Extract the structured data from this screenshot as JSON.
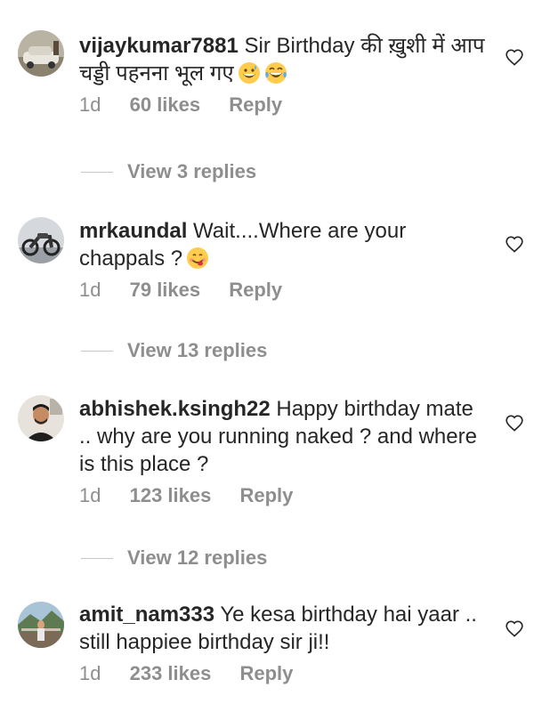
{
  "comments": [
    {
      "username": "vijaykumar7881",
      "text": "Sir Birthday की ख़ुशी में आप चड्डी पहनना भूल गए",
      "emojis": [
        "grinning-sweat-emoji",
        "tears-of-joy-emoji"
      ],
      "time": "1d",
      "likes": "60 likes",
      "reply": "Reply",
      "view_replies": "View 3 replies"
    },
    {
      "username": "mrkaundal",
      "text": "Wait....Where are your chappals ?",
      "emojis": [
        "yum-emoji"
      ],
      "time": "1d",
      "likes": "79 likes",
      "reply": "Reply",
      "view_replies": "View 13 replies"
    },
    {
      "username": "abhishek.ksingh22",
      "text": "Happy birthday mate .. why are you running naked ? and where is this place ?",
      "emojis": [],
      "time": "1d",
      "likes": "123 likes",
      "reply": "Reply",
      "view_replies": "View 12 replies"
    },
    {
      "username": "amit_nam333",
      "text": "Ye kesa birthday hai yaar .. still happiee birthday sir ji!!",
      "emojis": [],
      "time": "1d",
      "likes": "233 likes",
      "reply": "Reply",
      "view_replies": ""
    }
  ],
  "icons": {
    "like": "heart-outline-icon"
  },
  "colors": {
    "text": "#262626",
    "muted": "#8e8e8e",
    "divider": "#c7c7c7"
  }
}
